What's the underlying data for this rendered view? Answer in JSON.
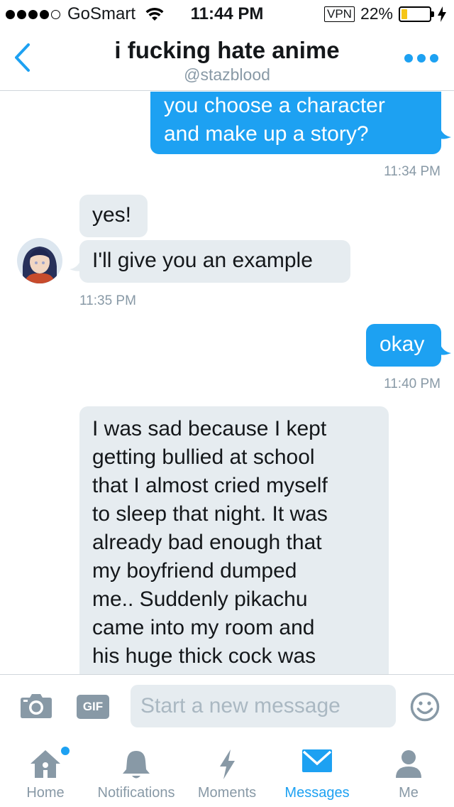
{
  "status_bar": {
    "carrier": "GoSmart",
    "time": "11:44 PM",
    "vpn": "VPN",
    "battery_percent": "22%",
    "battery_level": 0.22,
    "signal_bars_filled": 4,
    "signal_bars_total": 5
  },
  "header": {
    "title": "i fucking hate anime",
    "handle": "@stazblood"
  },
  "messages": [
    {
      "direction": "sent",
      "lines": [
        "you choose a character",
        "and make up a story?"
      ]
    },
    {
      "timestamp": "11:34 PM"
    },
    {
      "direction": "received",
      "lines": [
        "yes!"
      ]
    },
    {
      "direction": "received",
      "lines": [
        "I'll give you an example"
      ]
    },
    {
      "timestamp": "11:35 PM"
    },
    {
      "direction": "sent",
      "lines": [
        "okay"
      ]
    },
    {
      "timestamp": "11:40 PM"
    },
    {
      "direction": "received",
      "lines": [
        "I was sad because I kept",
        "getting bullied at school",
        "that I almost cried myself",
        "to sleep that night. It was",
        "already bad enough that",
        "my boyfriend dumped",
        "me.. Suddenly pikachu",
        "came into my room and",
        "his huge thick cock was"
      ]
    }
  ],
  "composer": {
    "placeholder": "Start a new message",
    "gif_label": "GIF",
    "camera_icon": "camera-icon",
    "emoji_icon": "emoji-icon"
  },
  "tab_bar": {
    "tabs": [
      {
        "label": "Home",
        "icon": "home-icon",
        "has_notification_dot": true
      },
      {
        "label": "Notifications",
        "icon": "bell-icon"
      },
      {
        "label": "Moments",
        "icon": "lightning-icon"
      },
      {
        "label": "Messages",
        "icon": "envelope-icon",
        "active": true
      },
      {
        "label": "Me",
        "icon": "person-icon"
      }
    ]
  },
  "colors": {
    "accent": "#1da1f2",
    "received_bubble": "#e6ecf0",
    "muted_text": "#8899a6",
    "battery_fill": "#f5c518"
  }
}
